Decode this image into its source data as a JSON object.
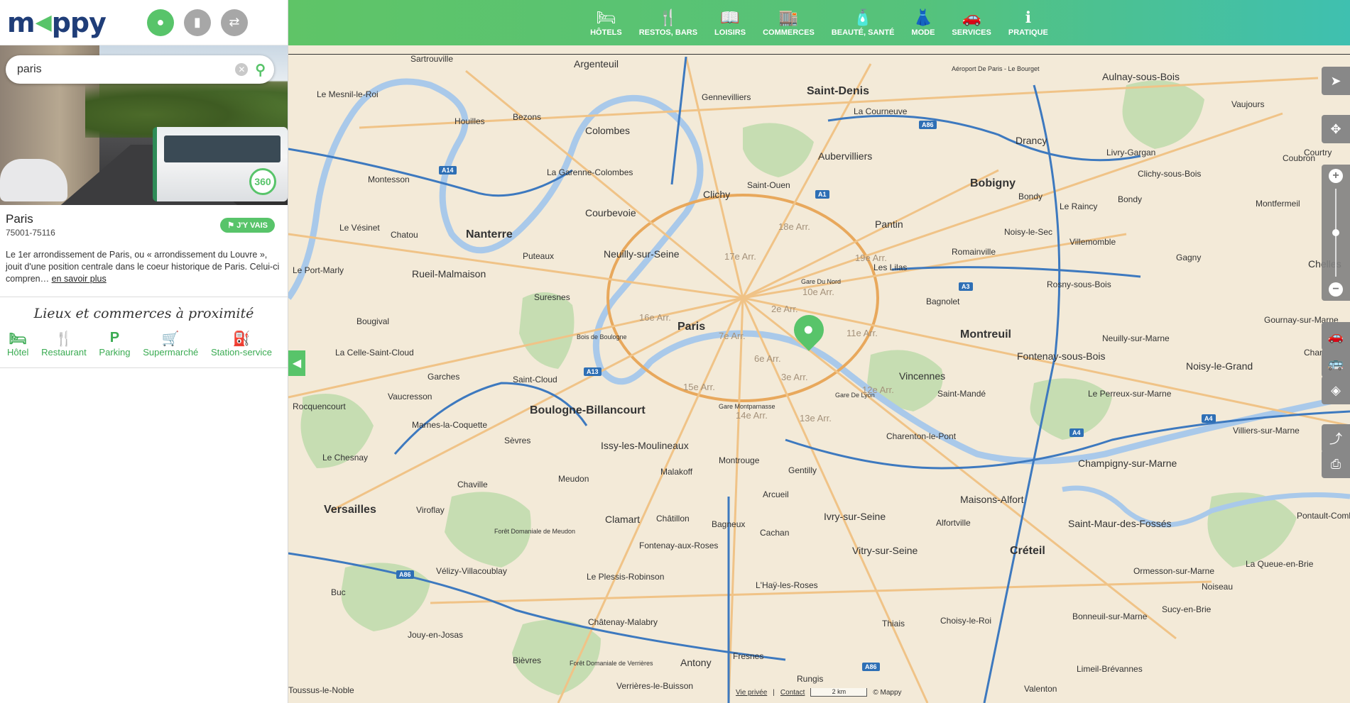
{
  "app": {
    "logo": {
      "text_left": "m",
      "text_right": "ppy",
      "arrow_glyph": "◀",
      "accent": "#58c46a",
      "brand": "#1f3d78"
    },
    "mode_buttons": [
      {
        "name": "place-mode-button",
        "icon": "map-pin-icon",
        "glyph": "●",
        "active": true
      },
      {
        "name": "route-mode-button",
        "icon": "bag-icon",
        "glyph": "▮",
        "active": false
      },
      {
        "name": "signpost-mode-button",
        "icon": "signpost-icon",
        "glyph": "⇄",
        "active": false
      }
    ]
  },
  "search": {
    "value": "paris",
    "clear_glyph": "✕",
    "search_glyph": "⚲"
  },
  "photo": {
    "badge": "360"
  },
  "place": {
    "name": "Paris",
    "zip": "75001-75116",
    "go_label": "J'Y VAIS",
    "go_glyph": "⚑",
    "description": "Le 1er arrondissement de Paris, ou « arrondissement du Louvre », jouit d'une position centrale dans le coeur historique de Paris. Celui-ci compren… ",
    "more_label": "en savoir plus"
  },
  "nearby": {
    "title": "Lieux et commerces à proximité",
    "items": [
      {
        "label": "Hôtel",
        "glyph": "🛏",
        "icon": "bed-icon"
      },
      {
        "label": "Restaurant",
        "glyph": "🍴",
        "icon": "cutlery-icon"
      },
      {
        "label": "Parking",
        "glyph": "P",
        "icon": "parking-icon"
      },
      {
        "label": "Supermarché",
        "glyph": "🛒",
        "icon": "cart-icon"
      },
      {
        "label": "Station-service",
        "glyph": "⛽",
        "icon": "fuel-icon"
      }
    ]
  },
  "categories": [
    {
      "label": "HÔTELS",
      "glyph": "🛏",
      "icon": "bed-icon"
    },
    {
      "label": "RESTOS, BARS",
      "glyph": "🍴",
      "icon": "cutlery-icon"
    },
    {
      "label": "LOISIRS",
      "glyph": "📖",
      "icon": "book-icon"
    },
    {
      "label": "COMMERCES",
      "glyph": "🏬",
      "icon": "shop-icon"
    },
    {
      "label": "BEAUTÉ, SANTÉ",
      "glyph": "🧴",
      "icon": "bottle-icon"
    },
    {
      "label": "MODE",
      "glyph": "👗",
      "icon": "dress-icon"
    },
    {
      "label": "SERVICES",
      "glyph": "🚗",
      "icon": "car-service-icon"
    },
    {
      "label": "PRATIQUE",
      "glyph": "ℹ",
      "icon": "info-icon"
    }
  ],
  "map_labels": {
    "cities_big": [
      "Paris",
      "Saint-Denis",
      "Nanterre",
      "Boulogne-Billancourt",
      "Versailles",
      "Montreuil",
      "Créteil",
      "Bobigny"
    ],
    "cities": [
      "Argenteuil",
      "Sartrouville",
      "Aulnay-sous-Bois",
      "Drancy",
      "Aubervilliers",
      "Colombes",
      "Courbevoie",
      "Clichy",
      "Pantin",
      "Rueil-Malmaison",
      "Neuilly-sur-Seine",
      "Vincennes",
      "Fontenay-sous-Bois",
      "Noisy-le-Grand",
      "Champigny-sur-Marne",
      "Issy-les-Moulineaux",
      "Ivry-sur-Seine",
      "Vitry-sur-Seine",
      "Maisons-Alfort",
      "Saint-Maur-des-Fossés",
      "Clamart",
      "Antony",
      "Bondy",
      "Gennevilliers",
      "Suresnes",
      "Le Vésinet",
      "Chatou",
      "Puteaux",
      "Garches",
      "Saint-Cloud",
      "Sèvres",
      "Meudon",
      "Vélizy-Villacoublay",
      "Chaville",
      "Viroflay",
      "Le Chesnay",
      "Vaucresson",
      "Bougival",
      "La Celle-Saint-Cloud",
      "Montesson",
      "Houilles",
      "Bezons",
      "La Garenne-Colombes",
      "Saint-Ouen",
      "La Courneuve",
      "Livry-Gargan",
      "Clichy-sous-Bois",
      "Le Raincy",
      "Villemomble",
      "Rosny-sous-Bois",
      "Romainville",
      "Les Lilas",
      "Bagnolet",
      "Noisy-le-Sec",
      "Montfermeil",
      "Gagny",
      "Neuilly-sur-Marne",
      "Le Perreux-sur-Marne",
      "Saint-Mandé",
      "Charenton-le-Pont",
      "Montrouge",
      "Malakoff",
      "Gentilly",
      "Arcueil",
      "Cachan",
      "Bagneux",
      "Châtillon",
      "Fontenay-aux-Roses",
      "Le Plessis-Robinson",
      "L'Haÿ-les-Roses",
      "Châtenay-Malabry",
      "Fresnes",
      "Thiais",
      "Choisy-le-Roi",
      "Alfortville",
      "Rungis",
      "Verrières-le-Buisson",
      "Bièvres",
      "Jouy-en-Josas",
      "Buc",
      "Sucy-en-Brie",
      "Bonneuil-sur-Marne",
      "Limeil-Brévannes",
      "Valenton",
      "La Queue-en-Brie",
      "Gournay-sur-Marne",
      "Villiers-sur-Marne",
      "Chelles",
      "Bondy",
      "Le Mesnil-le-Roi",
      "Le Port-Marly",
      "Rocquencourt",
      "Marnes-la-Coquette",
      "Toussus-le-Noble",
      "Vaujours",
      "Coubron",
      "Courtry",
      "Champs-sur-Marne",
      "Pontault-Combault",
      "Noiseau",
      "Ormesson-sur-Marne"
    ],
    "arrondissements": [
      "18e Arr.",
      "19e Arr.",
      "17e Arr.",
      "10e Arr.",
      "2e Arr.",
      "11e Arr.",
      "16e Arr.",
      "7e Arr.",
      "6e Arr.",
      "3e Arr.",
      "15e Arr.",
      "14e Arr.",
      "13e Arr.",
      "12e Arr."
    ],
    "roads": [
      "A86",
      "A14",
      "A1",
      "A3",
      "A13",
      "A4",
      "A86",
      "A86",
      "A4"
    ],
    "stations": [
      "Gare Du Nord",
      "Gare De Lyon",
      "Gare Montparnasse"
    ],
    "woods": [
      "Bois de Boulogne",
      "Forêt Domaniale de Meudon",
      "Forêt Domaniale de Verrières"
    ],
    "airport": "Aéroport De Paris - Le Bourget"
  },
  "tools": [
    {
      "name": "geolocate-button",
      "icon": "location-arrow-icon",
      "glyph": "➤"
    },
    {
      "name": "compass-button",
      "icon": "compass-icon",
      "glyph": "✥"
    },
    {
      "name": "traffic-button",
      "icon": "car-icon",
      "glyph": "🚗"
    },
    {
      "name": "transit-button",
      "icon": "bus-icon",
      "glyph": "🚌"
    },
    {
      "name": "layer-button",
      "icon": "layers-icon",
      "glyph": "◈"
    },
    {
      "name": "share-button",
      "icon": "share-icon",
      "glyph": "⤴"
    },
    {
      "name": "print-button",
      "icon": "print-icon",
      "glyph": "⎙"
    }
  ],
  "zoom": {
    "in": "+",
    "out": "−",
    "level_fraction": 0.5
  },
  "footer": {
    "privacy": "Vie privée",
    "contact": "Contact",
    "scale": "2 km",
    "copyright": "© Mappy"
  },
  "colors": {
    "accent": "#58c46a",
    "water": "#a9c9ea",
    "park": "#c3dcb0",
    "land": "#f3ead8",
    "highway": "#2e6fb5"
  }
}
